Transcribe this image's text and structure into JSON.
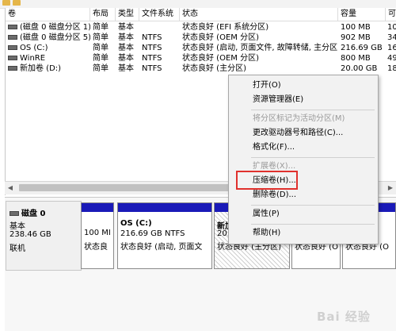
{
  "columns": {
    "vol": "卷",
    "layout": "布局",
    "type": "类型",
    "fs": "文件系统",
    "status": "状态",
    "capacity": "容量",
    "free": "可"
  },
  "rows": [
    {
      "vol": "(磁盘 0 磁盘分区 1)",
      "layout": "简单",
      "type": "基本",
      "fs": "",
      "status": "状态良好 (EFI 系统分区)",
      "capacity": "100 MB",
      "free": "10"
    },
    {
      "vol": "(磁盘 0 磁盘分区 5)",
      "layout": "简单",
      "type": "基本",
      "fs": "NTFS",
      "status": "状态良好 (OEM 分区)",
      "capacity": "902 MB",
      "free": "34"
    },
    {
      "vol": "OS (C:)",
      "layout": "简单",
      "type": "基本",
      "fs": "NTFS",
      "status": "状态良好 (启动, 页面文件, 故障转储, 主分区)",
      "capacity": "216.69 GB",
      "free": "16"
    },
    {
      "vol": "WinRE",
      "layout": "简单",
      "type": "基本",
      "fs": "NTFS",
      "status": "状态良好 (OEM 分区)",
      "capacity": "800 MB",
      "free": "49"
    },
    {
      "vol": "新加卷 (D:)",
      "layout": "简单",
      "type": "基本",
      "fs": "NTFS",
      "status": "状态良好 (主分区)",
      "capacity": "20.00 GB",
      "free": "18"
    }
  ],
  "disk": {
    "name": "磁盘 0",
    "type": "基本",
    "size": "238.46 GB",
    "state": "联机"
  },
  "partitions": [
    {
      "line1": "",
      "line2": "100 MI",
      "line3": "状态良"
    },
    {
      "line1": "OS  (C:)",
      "line2": "216.69 GB NTFS",
      "line3": "状态良好 (启动, 页面文"
    },
    {
      "line1": "新加",
      "line2": "20.0",
      "line3": "状态良好 (主分区)"
    },
    {
      "line1": "",
      "line2": "",
      "line3": "状态良好 (O"
    },
    {
      "line1": "",
      "line2": "",
      "line3": "状态良好 (O"
    }
  ],
  "menu": {
    "open": "打开(O)",
    "explorer": "资源管理器(E)",
    "mark_active": "将分区标记为活动分区(M)",
    "change_letter": "更改驱动器号和路径(C)...",
    "format": "格式化(F)...",
    "extend": "扩展卷(X)...",
    "shrink": "压缩卷(H)...",
    "delete": "删除卷(D)...",
    "properties": "属性(P)",
    "help": "帮助(H)"
  },
  "watermark": "Bai 经验",
  "colors": {
    "partition_bar": "#1a1ab8",
    "highlight_box": "#e0312d"
  }
}
